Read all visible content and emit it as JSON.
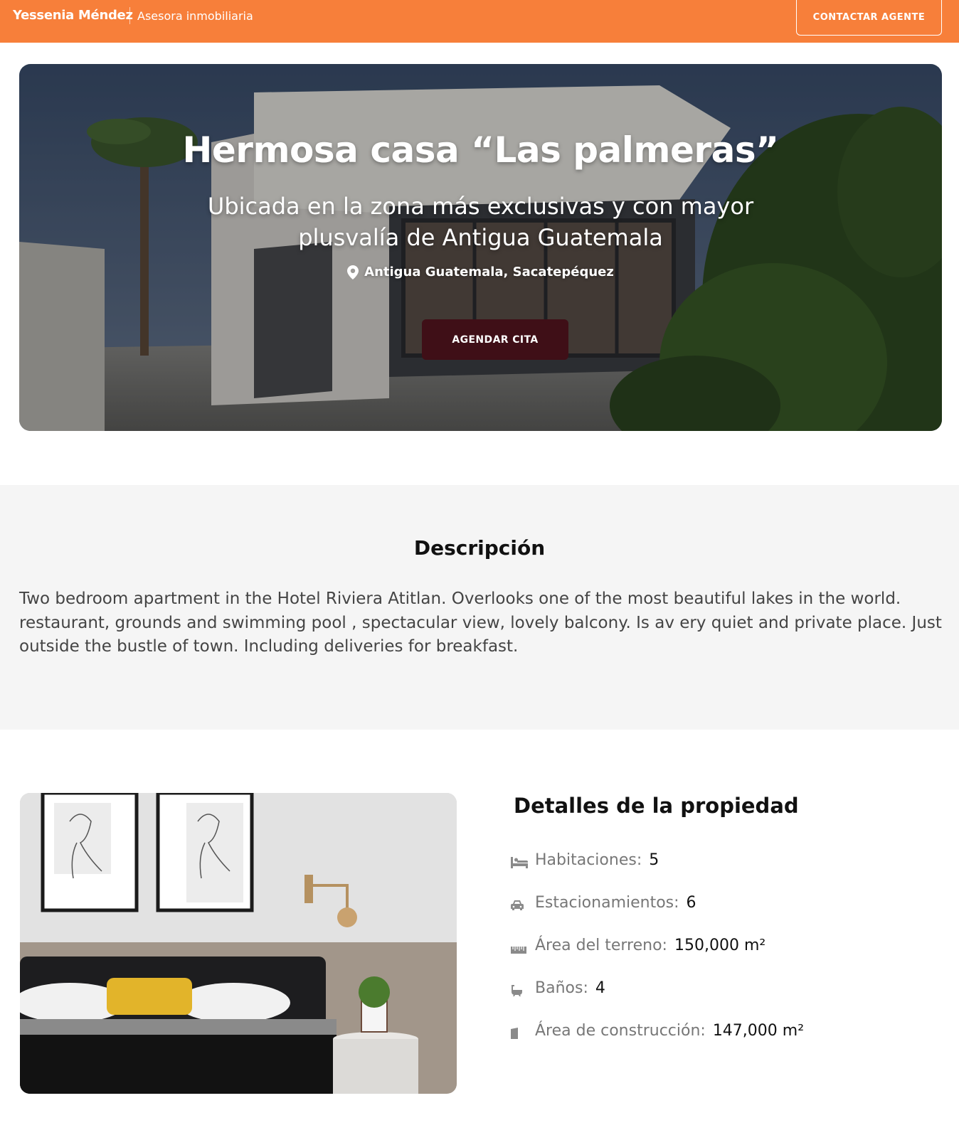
{
  "header": {
    "brand_name": "Yessenia Méndez",
    "brand_role": "Asesora inmobiliaria",
    "contact_button": "CONTACTAR AGENTE",
    "background_color": "#f77f3a"
  },
  "hero": {
    "title": "Hermosa casa “Las palmeras”",
    "subtitle": "Ubicada en la zona más exclusivas y con mayor plusvalía de Antigua Guatemala",
    "location": "Antigua Guatemala, Sacatepéquez",
    "cta_button": "AGENDAR CITA",
    "cta_color": "#3f0f17",
    "location_icon": "map-pin-icon"
  },
  "description": {
    "title": "Descripción",
    "text": "Two bedroom apartment in the Hotel Riviera Atitlan. Overlooks one of the most beautiful lakes in the world. restaurant, grounds and swimming pool , spectacular view, lovely balcony. Is av ery quiet and private place. Just outside the bustle of town. Including deliveries for breakfast."
  },
  "details": {
    "title": "Detalles de la propiedad",
    "items": [
      {
        "icon": "bed-icon",
        "label": "Habitaciones:",
        "value": "5"
      },
      {
        "icon": "car-icon",
        "label": "Estacionamientos:",
        "value": "6"
      },
      {
        "icon": "ruler-icon",
        "label": "Área del terreno:",
        "value": "150,000 m²"
      },
      {
        "icon": "bathtub-icon",
        "label": "Baños:",
        "value": "4"
      },
      {
        "icon": "building-icon",
        "label": "Área de construcción:",
        "value": "147,000 m²"
      }
    ]
  }
}
